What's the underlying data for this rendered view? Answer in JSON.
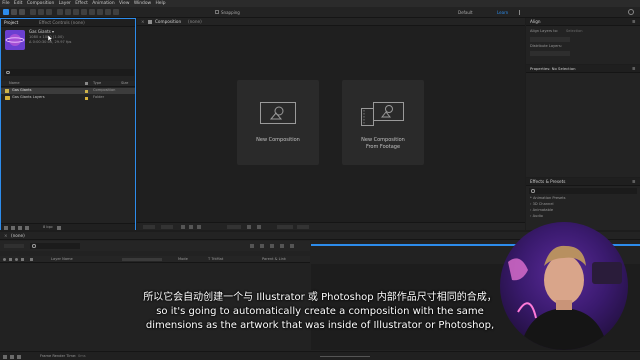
{
  "menu": [
    "File",
    "Edit",
    "Composition",
    "Layer",
    "Effect",
    "Animation",
    "View",
    "Window",
    "Help"
  ],
  "toolbar": {
    "snapping": "Snapping",
    "workspace_default": "Default",
    "workspace_learn": "Learn"
  },
  "project": {
    "tab_project": "Project",
    "tab_effect": "Effect Controls (none)",
    "preview_name": "Gas Giants ▾",
    "preview_line1": "1080 x 1080 (1.00)",
    "preview_line2": "Δ 0:00:30:00, 29.97 fps",
    "col_name": "Name",
    "col_type": "Type",
    "col_size": "Size",
    "items": [
      {
        "name": "Gas Giants",
        "type": "Composition"
      },
      {
        "name": "Gas Giants Layers",
        "type": "Folder"
      }
    ],
    "bpc": "8 bpc"
  },
  "composition": {
    "tab": "Composition",
    "tab_state": "(none)",
    "new_comp": "New Composition",
    "new_comp_footage_1": "New Composition",
    "new_comp_footage_2": "From Footage"
  },
  "right": {
    "align_title": "Align",
    "align_layers_to": "Align Layers to:",
    "align_selection": "Selection",
    "distribute": "Distribute Layers:",
    "properties": "Properties: No Selection",
    "effects_title": "Effects & Presets",
    "effects_items": [
      "* Animation Presets",
      "› 3D Channel",
      "› Animatable",
      "› Audio"
    ]
  },
  "timeline": {
    "tab": "(none)",
    "col_layer": "Layer Name",
    "col_mode": "Mode",
    "col_trkmat": "T TrkMat",
    "col_parent": "Parent & Link",
    "render_time": "Frame Render Time:",
    "render_value": "0ms"
  },
  "subtitles": {
    "zh": "所以它会自动创建一个与 Illustrator 或 Photoshop 内部作品尺寸相同的合成，",
    "en1": "so it's going to automatically create a composition with the same",
    "en2": "dimensions as the artwork that was inside of Illustrator or Photoshop,"
  },
  "colors": {
    "accent": "#2d8ceb",
    "comp_yellow": "#cdb24a",
    "folder_yellow": "#d6b13a",
    "purple": "#6b3fd1"
  }
}
